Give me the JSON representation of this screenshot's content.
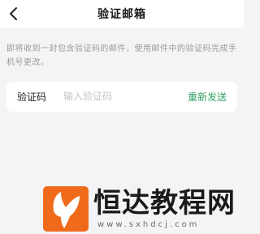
{
  "header": {
    "back_icon": "chevron-left-icon",
    "title": "验证邮箱"
  },
  "description": "即将收到一封包含验证码的邮件，使用邮件中的验证码完成手机号更改。",
  "verify_form": {
    "label": "验证码",
    "input_placeholder": "输入验证码",
    "input_value": "",
    "resend_label": "重新发送"
  },
  "watermark": {
    "logo_icon": "whale-tail-icon",
    "brand": "恒达教程网",
    "url": "www.sxhdcj.com"
  },
  "colors": {
    "accent": "#2e9f63",
    "logo": "#f06a1c",
    "background": "#f4f4f6"
  }
}
